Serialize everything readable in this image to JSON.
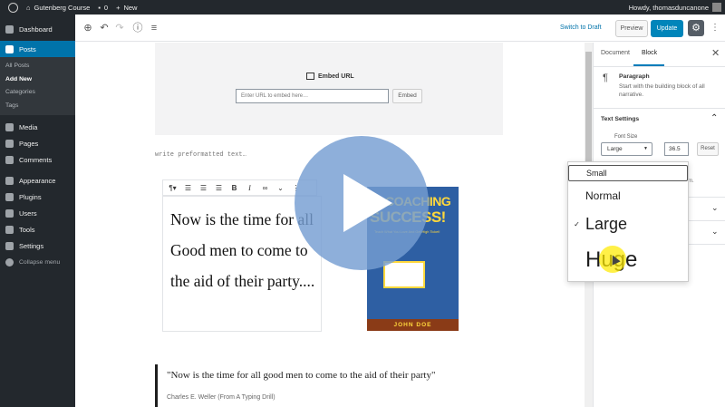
{
  "admin_bar": {
    "site_name": "Gutenberg Course",
    "comments_count": "0",
    "new_label": "New",
    "howdy": "Howdy, thomasduncanone"
  },
  "sidebar": {
    "dashboard": "Dashboard",
    "posts": "Posts",
    "posts_sub": [
      "All Posts",
      "Add New",
      "Categories",
      "Tags"
    ],
    "media": "Media",
    "pages": "Pages",
    "comments": "Comments",
    "appearance": "Appearance",
    "plugins": "Plugins",
    "users": "Users",
    "tools": "Tools",
    "settings": "Settings",
    "collapse": "Collapse menu"
  },
  "toolbar": {
    "switch_to_draft": "Switch to Draft",
    "preview": "Preview",
    "update": "Update"
  },
  "editor": {
    "embed_title": "Embed URL",
    "embed_placeholder": "Enter URL to embed here…",
    "embed_button": "Embed",
    "preformatted_placeholder": "write preformatted text…",
    "paragraph_text": "Now is the time for all Good men to come to the aid of their party....",
    "quote_text": "\"Now is the time for all good men to come to the aid of their party\"",
    "quote_citation": "Charles E. Weller (From A Typing Drill)"
  },
  "book": {
    "title_prefix": "e",
    "title_line1": "COACHING",
    "title_line2": "SUCCESS!",
    "subtitle": "Teach What You Love And Get High Ticket!",
    "author": "JOHN DOE"
  },
  "panel": {
    "tab_document": "Document",
    "tab_block": "Block",
    "block_name": "Paragraph",
    "block_description": "Start with the building block of all narrative.",
    "text_settings": "Text Settings",
    "font_size_label": "Font Size",
    "font_size_value": "Large",
    "font_size_number": "36.5",
    "reset": "Reset",
    "partial_text": "m."
  },
  "font_size_dropdown": {
    "options": [
      "Small",
      "Normal",
      "Large",
      "Huge"
    ],
    "selected": "Large",
    "check_mark": "✓"
  },
  "colors": {
    "admin_dark": "#23282d",
    "accent_blue": "#0073aa",
    "update_blue": "#0085ba",
    "play_overlay": "#759ed2",
    "cursor_highlight": "#ffea00"
  }
}
